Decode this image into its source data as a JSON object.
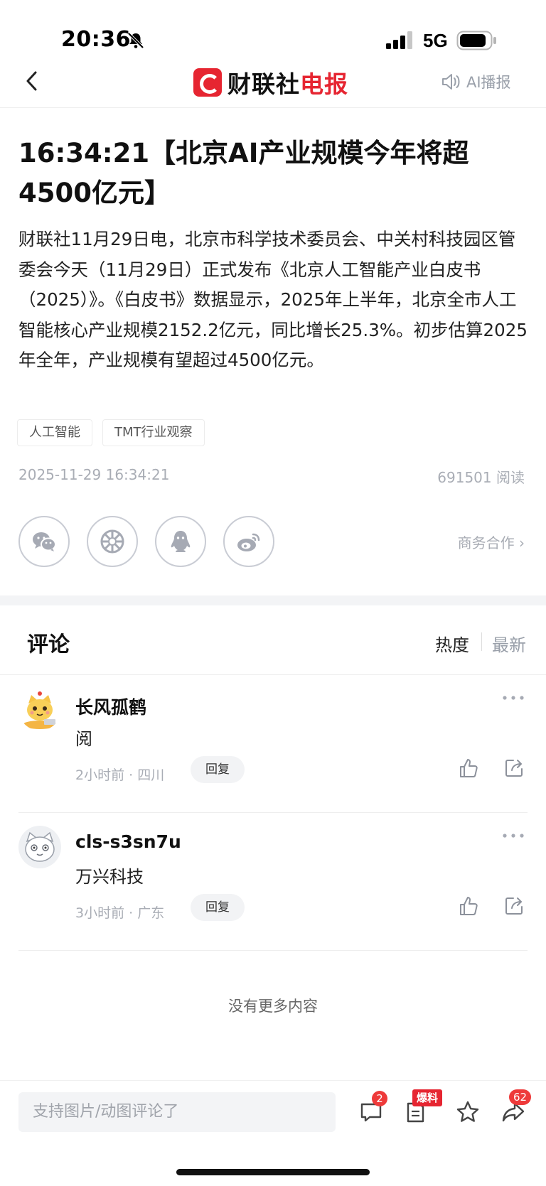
{
  "status_bar": {
    "time": "20:36",
    "network": "5G"
  },
  "nav": {
    "brand_name": "财联社",
    "brand_accent": "电报",
    "ai_read_label": "AI播报"
  },
  "article": {
    "title": "16:34:21【北京AI产业规模今年将超4500亿元】",
    "body": "财联社11月29日电，北京市科学技术委员会、中关村科技园区管委会今天（11月29日）正式发布《北京人工智能产业白皮书（2025）》。《白皮书》数据显示，2025年上半年，北京全市人工智能核心产业规模2152.2亿元，同比增长25.3%。初步估算2025年全年，产业规模有望超过4500亿元。",
    "tags": [
      "人工智能",
      "TMT行业观察"
    ],
    "date": "2025-11-29 16:34:21",
    "reads": "691501 阅读",
    "share_targets": [
      "wechat-icon",
      "moments-icon",
      "qq-icon",
      "weibo-icon"
    ],
    "business_link": "商务合作 ›"
  },
  "comments_section": {
    "title": "评论",
    "sort_hot": "热度",
    "sort_new": "最新",
    "items": [
      {
        "user": "长风孤鹤",
        "text": "阅",
        "meta": "2小时前 · 四川",
        "reply_label": "回复"
      },
      {
        "user": "cls-s3sn7u",
        "text": "万兴科技",
        "meta": "3小时前 · 广东",
        "reply_label": "回复"
      }
    ],
    "no_more": "没有更多内容"
  },
  "bottom_bar": {
    "input_placeholder": "支持图片/动图评论了",
    "comment_badge": "2",
    "tip_badge": "爆料",
    "share_badge": "62"
  },
  "colors": {
    "brand_red": "#e62531",
    "muted": "#a9adb5",
    "badge": "#ee3a3a"
  }
}
